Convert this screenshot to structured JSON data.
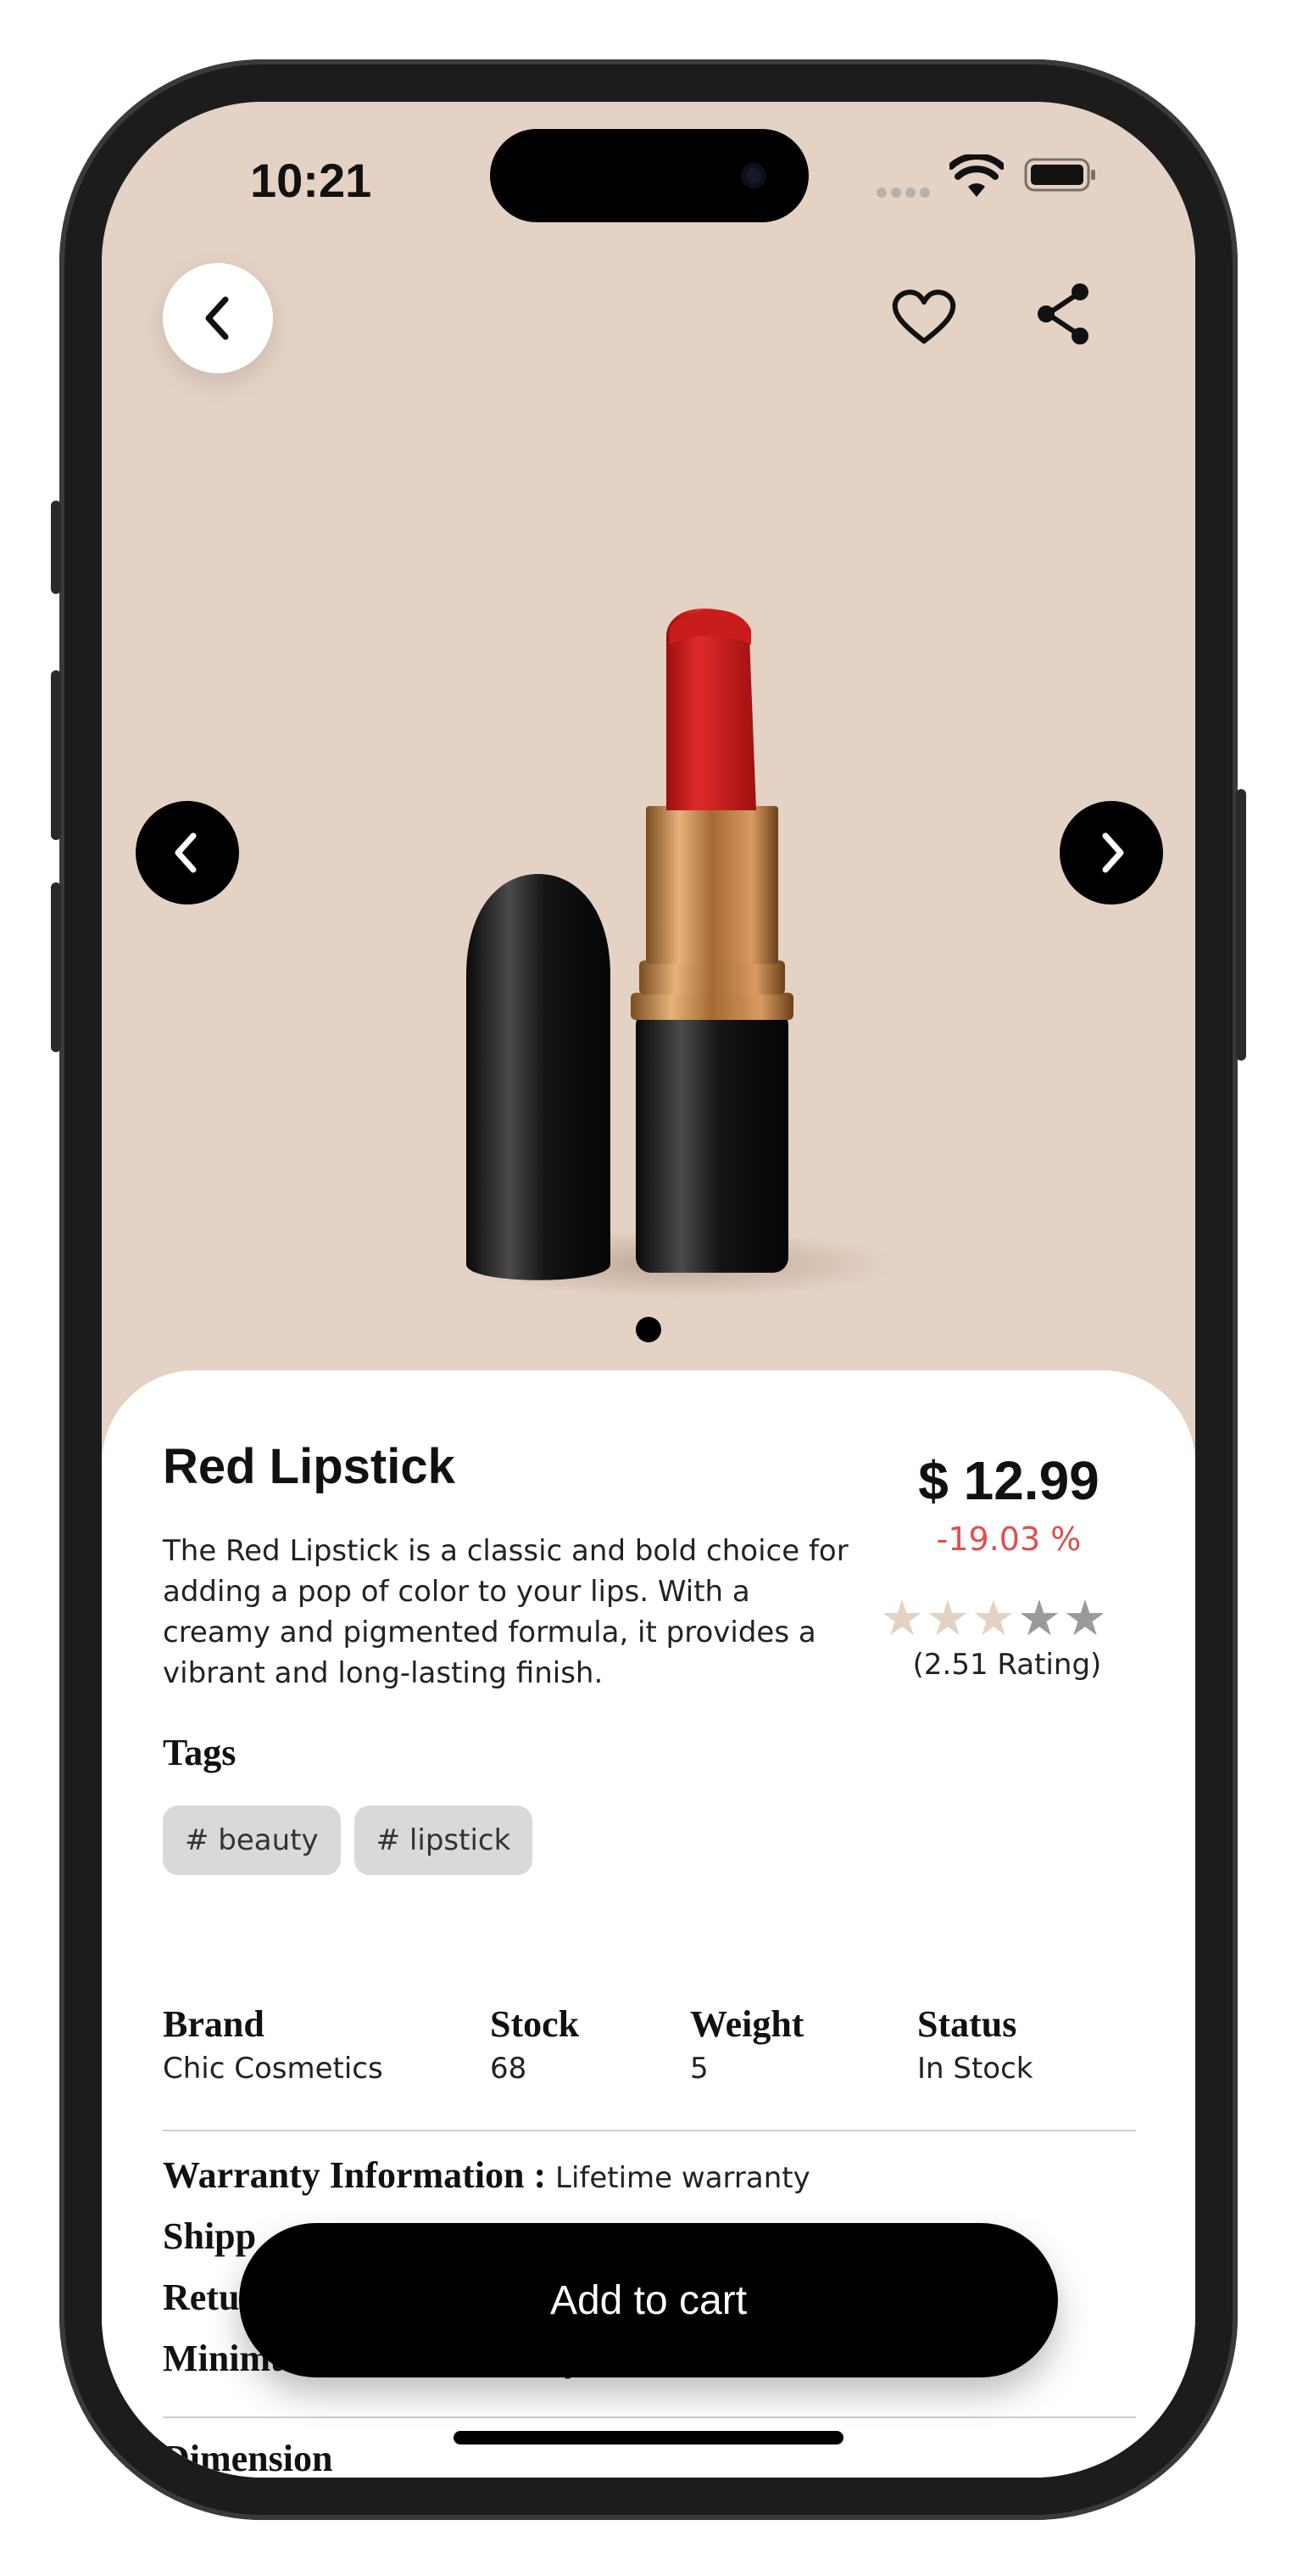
{
  "status_bar": {
    "time": "10:21"
  },
  "product": {
    "title": "Red Lipstick",
    "price": "$ 12.99",
    "discount": "-19.03 %",
    "description": "The Red Lipstick is a classic and bold choice for adding a pop of color to your lips. With a creamy and pigmented formula, it provides a vibrant and long-lasting finish.",
    "rating_value": 2.51,
    "rating_text": "(2.51 Rating)",
    "image_count": 1,
    "current_image": 1
  },
  "tags": {
    "heading": "Tags",
    "items": [
      "# beauty",
      "# lipstick"
    ]
  },
  "specs": [
    {
      "label": "Brand",
      "value": "Chic Cosmetics"
    },
    {
      "label": "Stock",
      "value": "68"
    },
    {
      "label": "Weight",
      "value": "5"
    },
    {
      "label": "Status",
      "value": "In Stock"
    }
  ],
  "info": {
    "warranty_label": "Warranty Information :",
    "warranty_value": "Lifetime warranty",
    "shipping_label_partial": "Shipp",
    "return_label_partial": "Retu",
    "min_order_label": "Minimum Order Quantity :"
  },
  "dimension_heading": "Dimension",
  "cart_button": "Add to cart",
  "icons": {
    "back": "chevron-left-icon",
    "favorite": "heart-icon",
    "share": "share-icon",
    "prev": "chevron-left-icon",
    "next": "chevron-right-icon"
  },
  "colors": {
    "hero_bg": "#e4d2c4",
    "discount": "#e04e4e",
    "star_filled": "#e4d2c4",
    "star_empty": "#9a9a9a"
  }
}
